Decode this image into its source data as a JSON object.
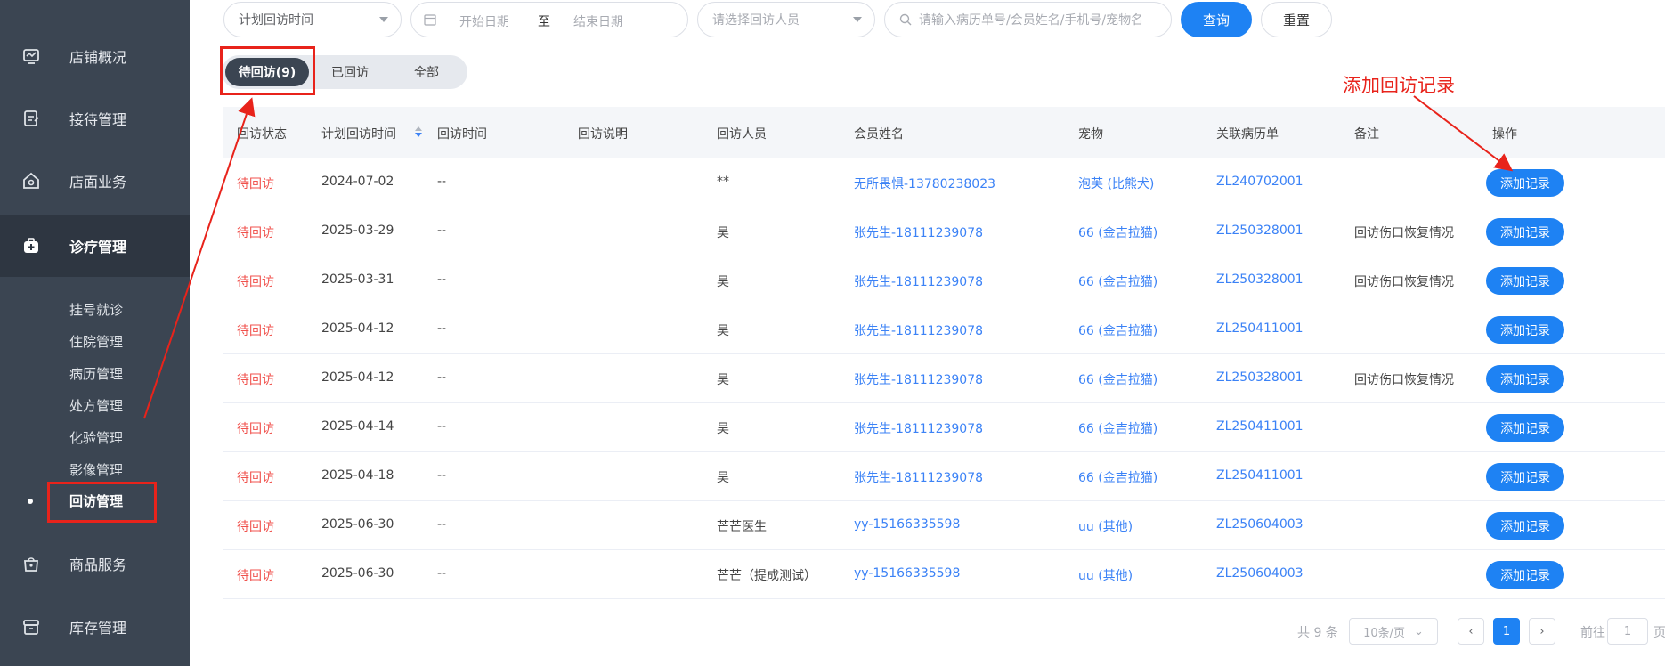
{
  "sidebar": {
    "items": [
      {
        "label": "店铺概况",
        "icon": "dashboard-icon"
      },
      {
        "label": "接待管理",
        "icon": "reception-icon"
      },
      {
        "label": "店面业务",
        "icon": "store-icon"
      },
      {
        "label": "诊疗管理",
        "icon": "medical-kit-icon"
      },
      {
        "label": "商品服务",
        "icon": "bag-icon"
      },
      {
        "label": "库存管理",
        "icon": "inventory-icon"
      }
    ],
    "sub_items": [
      "挂号就诊",
      "住院管理",
      "病历管理",
      "处方管理",
      "化验管理",
      "影像管理",
      "回访管理"
    ]
  },
  "filters": {
    "plan_time": "计划回访时间",
    "start_date": "开始日期",
    "date_sep": "至",
    "end_date": "结束日期",
    "staff_placeholder": "请选择回访人员",
    "search_placeholder": "请输入病历单号/会员姓名/手机号/宠物名",
    "query": "查询",
    "reset": "重置"
  },
  "tabs": [
    "待回访(9)",
    "已回访",
    "全部"
  ],
  "table": {
    "headers": [
      "回访状态",
      "计划回访时间",
      "回访时间",
      "回访说明",
      "回访人员",
      "会员姓名",
      "宠物",
      "关联病历单",
      "备注",
      "操作"
    ],
    "action_label": "添加记录",
    "rows": [
      {
        "status": "待回访",
        "plan": "2024-07-02",
        "time": "--",
        "desc": "",
        "staff": "**",
        "member": "无所畏惧-13780238023",
        "pet": "泡芙 (比熊犬)",
        "record": "ZL240702001",
        "note": ""
      },
      {
        "status": "待回访",
        "plan": "2025-03-29",
        "time": "--",
        "desc": "",
        "staff": "吴",
        "member": "张先生-18111239078",
        "pet": "66 (金吉拉猫)",
        "record": "ZL250328001",
        "note": "回访伤口恢复情况"
      },
      {
        "status": "待回访",
        "plan": "2025-03-31",
        "time": "--",
        "desc": "",
        "staff": "吴",
        "member": "张先生-18111239078",
        "pet": "66 (金吉拉猫)",
        "record": "ZL250328001",
        "note": "回访伤口恢复情况"
      },
      {
        "status": "待回访",
        "plan": "2025-04-12",
        "time": "--",
        "desc": "",
        "staff": "吴",
        "member": "张先生-18111239078",
        "pet": "66 (金吉拉猫)",
        "record": "ZL250411001",
        "note": ""
      },
      {
        "status": "待回访",
        "plan": "2025-04-12",
        "time": "--",
        "desc": "",
        "staff": "吴",
        "member": "张先生-18111239078",
        "pet": "66 (金吉拉猫)",
        "record": "ZL250328001",
        "note": "回访伤口恢复情况"
      },
      {
        "status": "待回访",
        "plan": "2025-04-14",
        "time": "--",
        "desc": "",
        "staff": "吴",
        "member": "张先生-18111239078",
        "pet": "66 (金吉拉猫)",
        "record": "ZL250411001",
        "note": ""
      },
      {
        "status": "待回访",
        "plan": "2025-04-18",
        "time": "--",
        "desc": "",
        "staff": "吴",
        "member": "张先生-18111239078",
        "pet": "66 (金吉拉猫)",
        "record": "ZL250411001",
        "note": ""
      },
      {
        "status": "待回访",
        "plan": "2025-06-30",
        "time": "--",
        "desc": "",
        "staff": "芒芒医生",
        "member": "yy-15166335598",
        "pet": "uu (其他)",
        "record": "ZL250604003",
        "note": ""
      },
      {
        "status": "待回访",
        "plan": "2025-06-30",
        "time": "--",
        "desc": "",
        "staff": "芒芒（提成测试）",
        "member": "yy-15166335598",
        "pet": "uu (其他)",
        "record": "ZL250604003",
        "note": ""
      }
    ]
  },
  "pagination": {
    "total": "共 9 条",
    "page_size": "10条/页",
    "current_page": "1",
    "goto_label": "前往",
    "goto_value": "1",
    "page_suffix": "页"
  },
  "annotation": {
    "text": "添加回访记录"
  },
  "colors": {
    "sidebar": "#3b4552",
    "accent": "#1e82f3",
    "status_red": "#f0524d",
    "link": "#3b82f6",
    "annotation": "#e8231b"
  }
}
